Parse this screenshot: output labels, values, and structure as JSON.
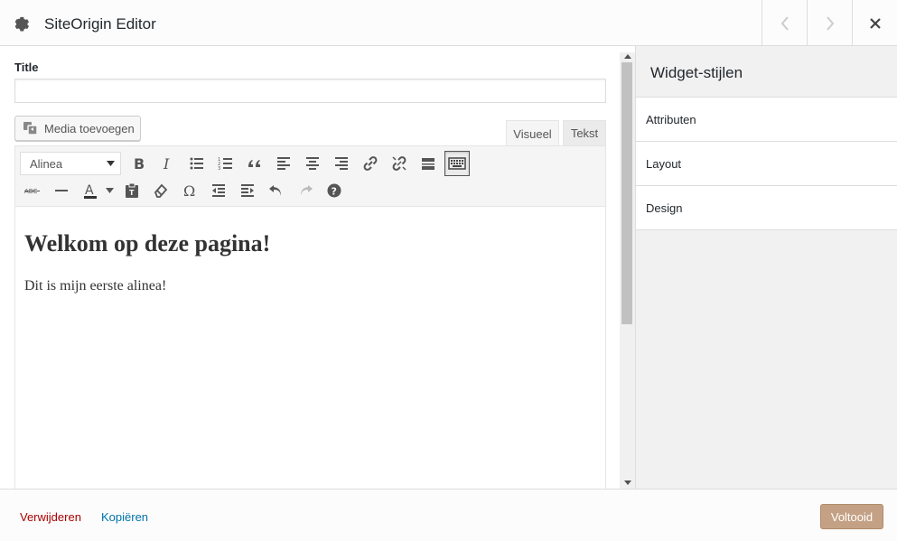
{
  "window": {
    "title": "SiteOrigin Editor",
    "icon": "gear-icon"
  },
  "nav": {
    "prev_icon": "chevron-left-icon",
    "next_icon": "chevron-right-icon",
    "close_icon": "close-icon"
  },
  "form": {
    "title_label": "Title",
    "title_value": "",
    "media_button": "Media toevoegen"
  },
  "editor": {
    "tabs": [
      {
        "label": "Visueel",
        "active": true
      },
      {
        "label": "Tekst",
        "active": false
      }
    ],
    "format_select": "Alinea",
    "toolbar_row1_icons": [
      "bold-icon",
      "italic-icon",
      "bullet-list-icon",
      "numbered-list-icon",
      "blockquote-icon",
      "align-left-icon",
      "align-center-icon",
      "align-right-icon",
      "link-icon",
      "unlink-icon",
      "read-more-icon",
      "toolbar-toggle-icon"
    ],
    "toolbar_row2_icons": [
      "strikethrough-icon",
      "horizontal-line-icon",
      "text-color-icon",
      "paste-text-icon",
      "clear-formatting-icon",
      "special-character-icon",
      "outdent-icon",
      "indent-icon",
      "undo-icon",
      "redo-icon",
      "help-icon"
    ],
    "content": {
      "heading": "Welkom op deze pagina!",
      "paragraph": "Dit is mijn eerste alinea!"
    }
  },
  "sidebar": {
    "title": "Widget-stijlen",
    "items": [
      {
        "label": "Attributen"
      },
      {
        "label": "Layout"
      },
      {
        "label": "Design"
      }
    ]
  },
  "footer": {
    "delete_label": "Verwijderen",
    "copy_label": "Kopiëren",
    "done_label": "Voltooid"
  },
  "colors": {
    "accent_done": "#c4a184",
    "delete_link": "#aa0000",
    "copy_link": "#0073aa"
  }
}
